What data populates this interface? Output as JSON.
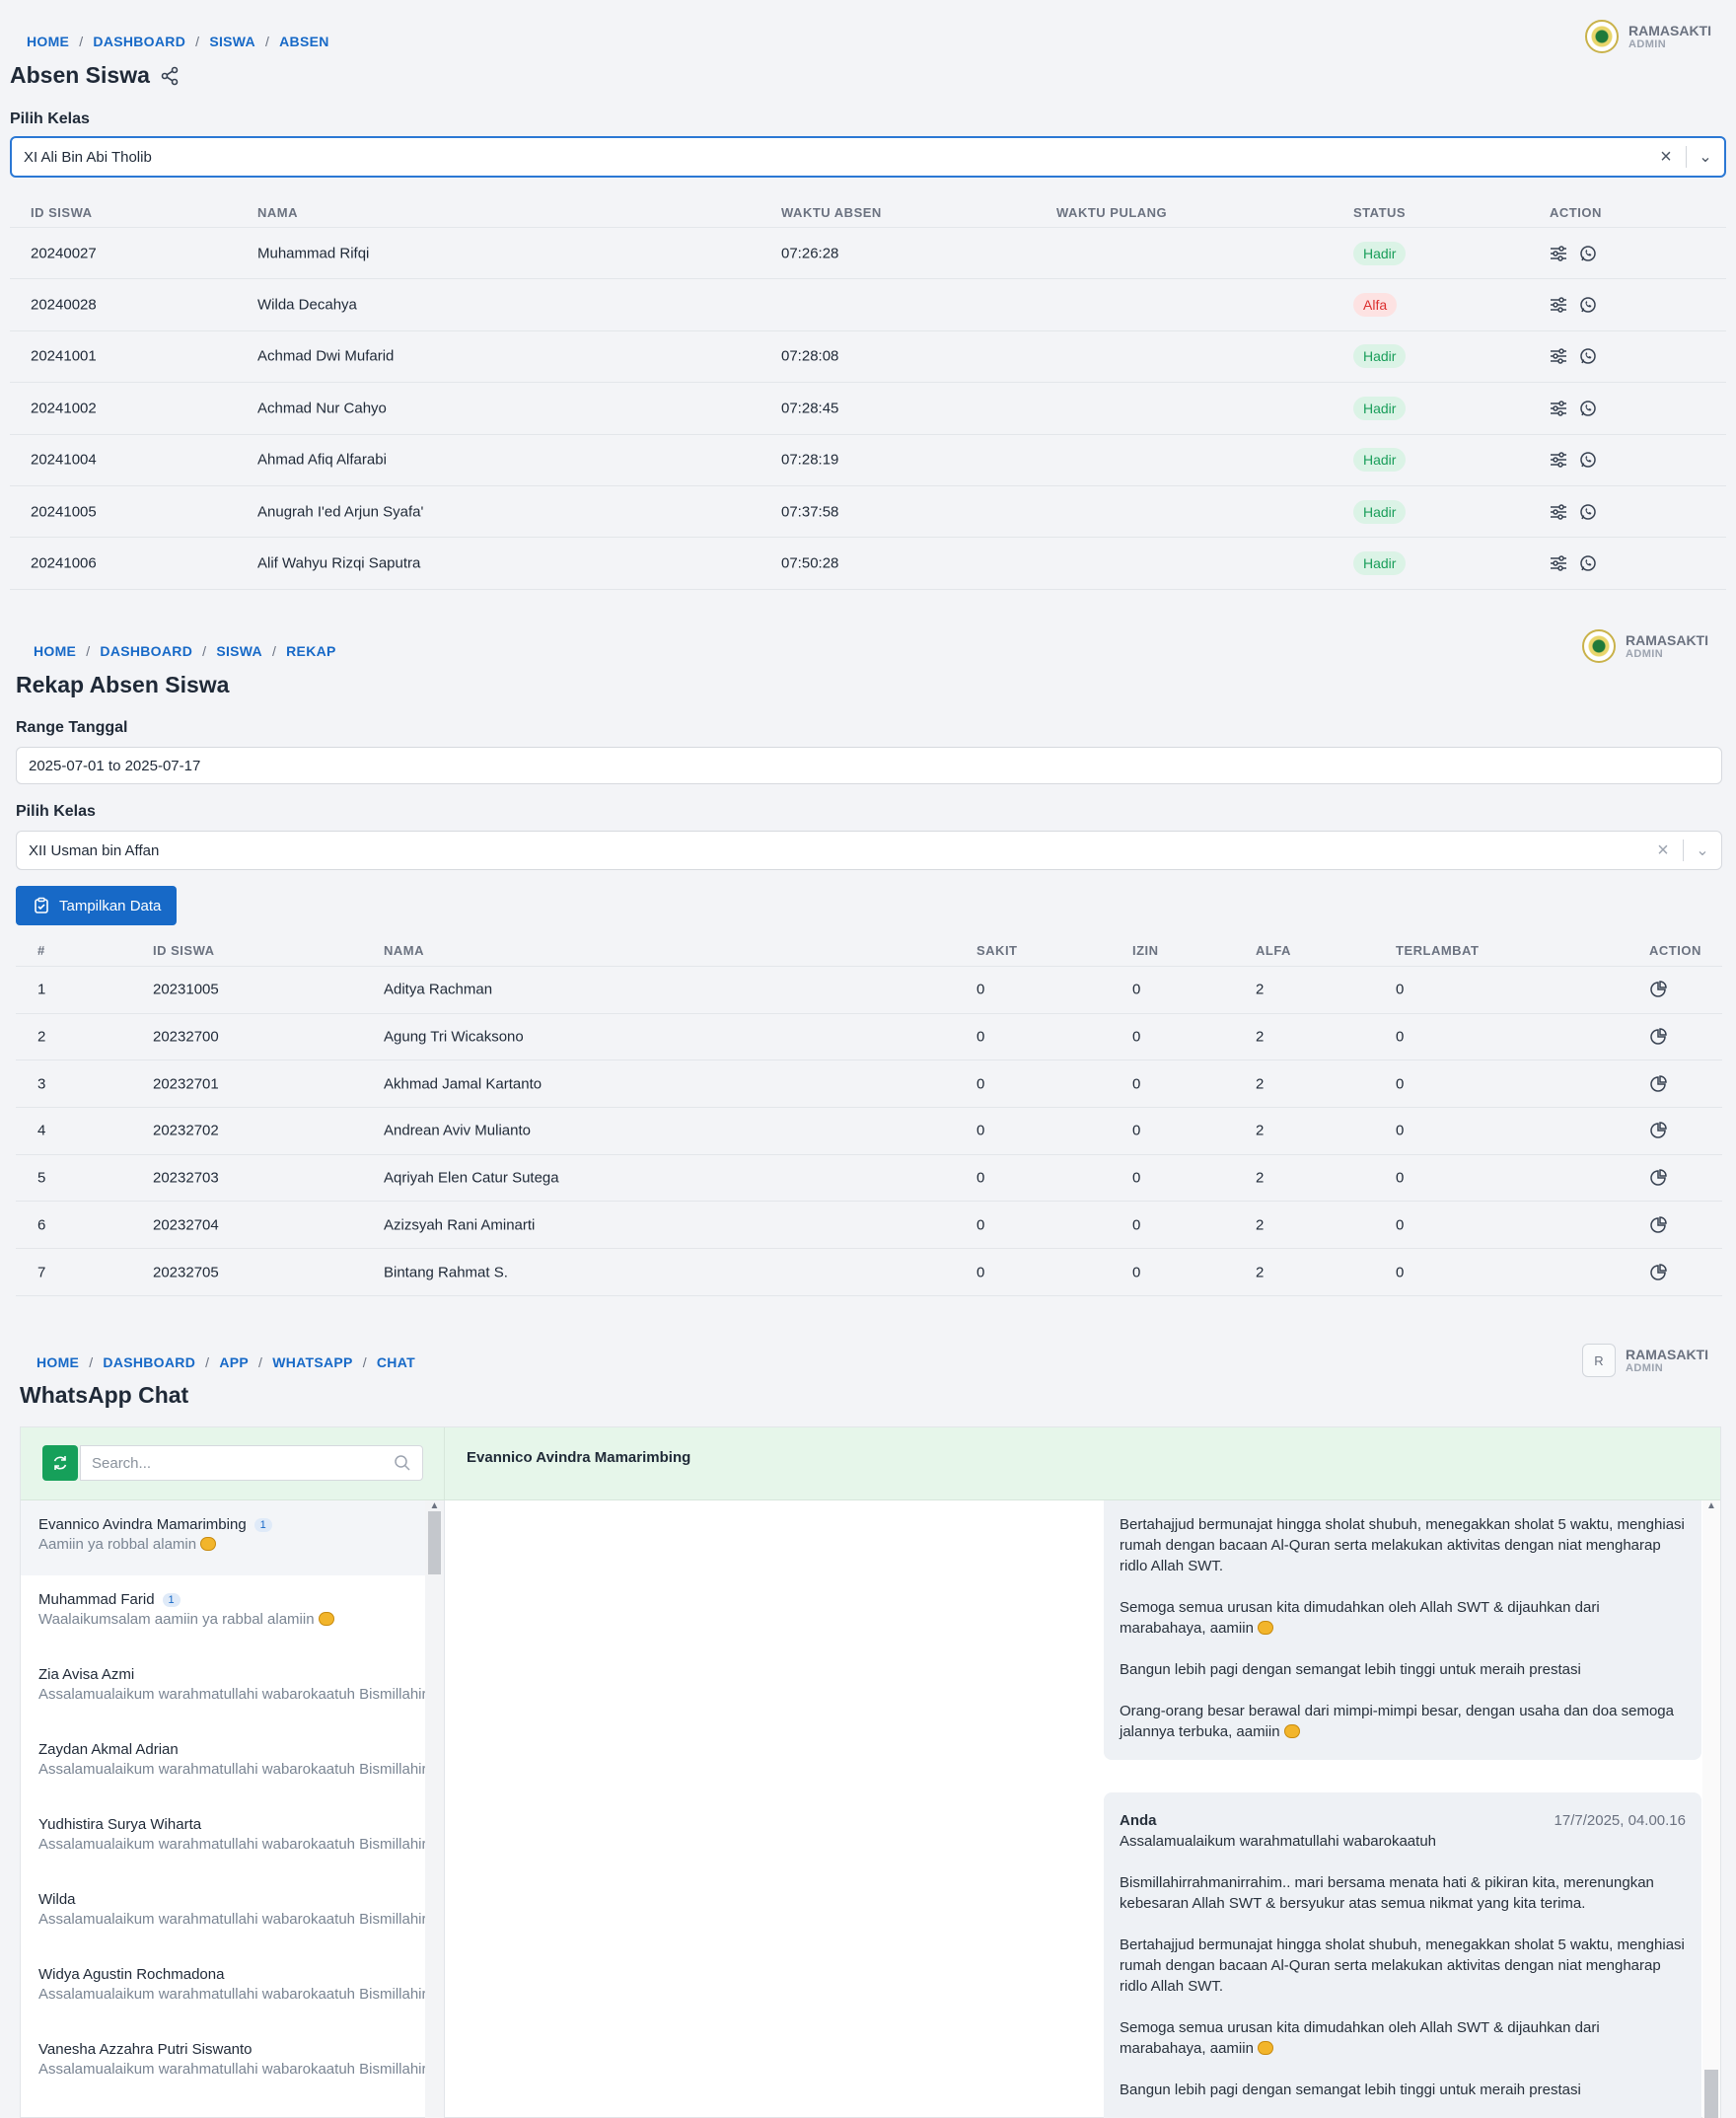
{
  "absen": {
    "breadcrumb": [
      "HOME",
      "DASHBOARD",
      "SISWA",
      "ABSEN"
    ],
    "user": {
      "name": "RAMASAKTI",
      "role": "ADMIN"
    },
    "title": "Absen Siswa",
    "pilih_label": "Pilih Kelas",
    "kelas": "XI Ali Bin Abi Tholib",
    "headers": [
      "ID SISWA",
      "NAMA",
      "WAKTU ABSEN",
      "WAKTU PULANG",
      "STATUS",
      "ACTION"
    ],
    "rows": [
      {
        "id": "20240027",
        "nama": "Muhammad Rifqi",
        "absen": "07:26:28",
        "pulang": "",
        "status": "Hadir"
      },
      {
        "id": "20240028",
        "nama": "Wilda Decahya",
        "absen": "",
        "pulang": "",
        "status": "Alfa"
      },
      {
        "id": "20241001",
        "nama": "Achmad Dwi Mufarid",
        "absen": "07:28:08",
        "pulang": "",
        "status": "Hadir"
      },
      {
        "id": "20241002",
        "nama": "Achmad Nur Cahyo",
        "absen": "07:28:45",
        "pulang": "",
        "status": "Hadir"
      },
      {
        "id": "20241004",
        "nama": "Ahmad Afiq Alfarabi",
        "absen": "07:28:19",
        "pulang": "",
        "status": "Hadir"
      },
      {
        "id": "20241005",
        "nama": "Anugrah I'ed Arjun Syafa'",
        "absen": "07:37:58",
        "pulang": "",
        "status": "Hadir"
      },
      {
        "id": "20241006",
        "nama": "Alif Wahyu Rizqi Saputra",
        "absen": "07:50:28",
        "pulang": "",
        "status": "Hadir"
      }
    ]
  },
  "rekap": {
    "breadcrumb": [
      "HOME",
      "DASHBOARD",
      "SISWA",
      "REKAP"
    ],
    "user": {
      "name": "RAMASAKTI",
      "role": "ADMIN"
    },
    "title": "Rekap Absen Siswa",
    "range_label": "Range Tanggal",
    "range": "2025-07-01 to 2025-07-17",
    "pilih_label": "Pilih Kelas",
    "kelas": "XII Usman bin Affan",
    "button": "Tampilkan Data",
    "headers": [
      "#",
      "ID SISWA",
      "NAMA",
      "SAKIT",
      "IZIN",
      "ALFA",
      "TERLAMBAT",
      "ACTION"
    ],
    "rows": [
      {
        "no": "1",
        "id": "20231005",
        "nama": "Aditya Rachman",
        "sakit": "0",
        "izin": "0",
        "alfa": "2",
        "terlambat": "0"
      },
      {
        "no": "2",
        "id": "20232700",
        "nama": "Agung Tri Wicaksono",
        "sakit": "0",
        "izin": "0",
        "alfa": "2",
        "terlambat": "0"
      },
      {
        "no": "3",
        "id": "20232701",
        "nama": "Akhmad Jamal Kartanto",
        "sakit": "0",
        "izin": "0",
        "alfa": "2",
        "terlambat": "0"
      },
      {
        "no": "4",
        "id": "20232702",
        "nama": "Andrean Aviv Mulianto",
        "sakit": "0",
        "izin": "0",
        "alfa": "2",
        "terlambat": "0"
      },
      {
        "no": "5",
        "id": "20232703",
        "nama": "Aqriyah Elen Catur Sutega",
        "sakit": "0",
        "izin": "0",
        "alfa": "2",
        "terlambat": "0"
      },
      {
        "no": "6",
        "id": "20232704",
        "nama": "Azizsyah Rani Aminarti",
        "sakit": "0",
        "izin": "0",
        "alfa": "2",
        "terlambat": "0"
      },
      {
        "no": "7",
        "id": "20232705",
        "nama": "Bintang Rahmat S.",
        "sakit": "0",
        "izin": "0",
        "alfa": "2",
        "terlambat": "0"
      }
    ]
  },
  "wa": {
    "breadcrumb": [
      "HOME",
      "DASHBOARD",
      "APP",
      "WHATSAPP",
      "CHAT"
    ],
    "user": {
      "initial": "R",
      "name": "RAMASAKTI",
      "role": "ADMIN"
    },
    "title": "WhatsApp Chat",
    "search_placeholder": "Search...",
    "active_chat": "Evannico Avindra Mamarimbing",
    "contacts": [
      {
        "name": "Evannico Avindra Mamarimbing",
        "count": "1",
        "msg": "Aamiin ya robbal alamin"
      },
      {
        "name": "Muhammad Farid",
        "count": "1",
        "msg": "Waalaikumsalam aamiin ya rabbal alamiin"
      },
      {
        "name": "Zia Avisa Azmi",
        "count": "",
        "msg": "Assalamualaikum warahmatullahi wabarokaatuh Bismillahirrahmanirrahim"
      },
      {
        "name": "Zaydan Akmal Adrian",
        "count": "",
        "msg": "Assalamualaikum warahmatullahi wabarokaatuh Bismillahirrahmanirrahim"
      },
      {
        "name": "Yudhistira Surya Wiharta",
        "count": "",
        "msg": "Assalamualaikum warahmatullahi wabarokaatuh Bismillahirrahmanirrahim"
      },
      {
        "name": "Wilda",
        "count": "",
        "msg": "Assalamualaikum warahmatullahi wabarokaatuh Bismillahirrahmanirrahim"
      },
      {
        "name": "Widya Agustin Rochmadona",
        "count": "",
        "msg": "Assalamualaikum warahmatullahi wabarokaatuh Bismillahirrahmanirrahim"
      },
      {
        "name": "Vanesha Azzahra Putri Siswanto",
        "count": "",
        "msg": "Assalamualaikum warahmatullahi wabarokaatuh Bismillahirrahmanirrahim"
      }
    ],
    "msg1": [
      "Bertahajjud bermunajat hingga sholat shubuh, menegakkan sholat 5 waktu, menghiasi rumah dengan bacaan Al-Quran serta melakukan aktivitas dengan niat mengharap ridlo Allah SWT.",
      "Semoga semua urusan kita dimudahkan oleh Allah SWT & dijauhkan dari marabahaya, aamiin",
      "Bangun lebih pagi dengan semangat lebih tinggi untuk meraih prestasi",
      "Orang-orang besar berawal dari mimpi-mimpi besar, dengan usaha dan doa semoga jalannya terbuka, aamiin"
    ],
    "msg2": {
      "sender": "Anda",
      "time": "17/7/2025, 04.00.16",
      "greeting": "Assalamualaikum warahmatullahi wabarokaatuh",
      "paras": [
        "Bismillahirrahmanirrahim.. mari bersama menata hati & pikiran kita, merenungkan kebesaran Allah SWT & bersyukur atas semua nikmat yang kita terima.",
        "Bertahajjud bermunajat hingga sholat shubuh, menegakkan sholat 5 waktu, menghiasi rumah dengan bacaan Al-Quran serta melakukan aktivitas dengan niat mengharap ridlo Allah SWT.",
        "Semoga semua urusan kita dimudahkan oleh Allah SWT & dijauhkan dari marabahaya, aamiin",
        "Bangun lebih pagi dengan semangat lebih tinggi untuk meraih prestasi"
      ]
    }
  }
}
